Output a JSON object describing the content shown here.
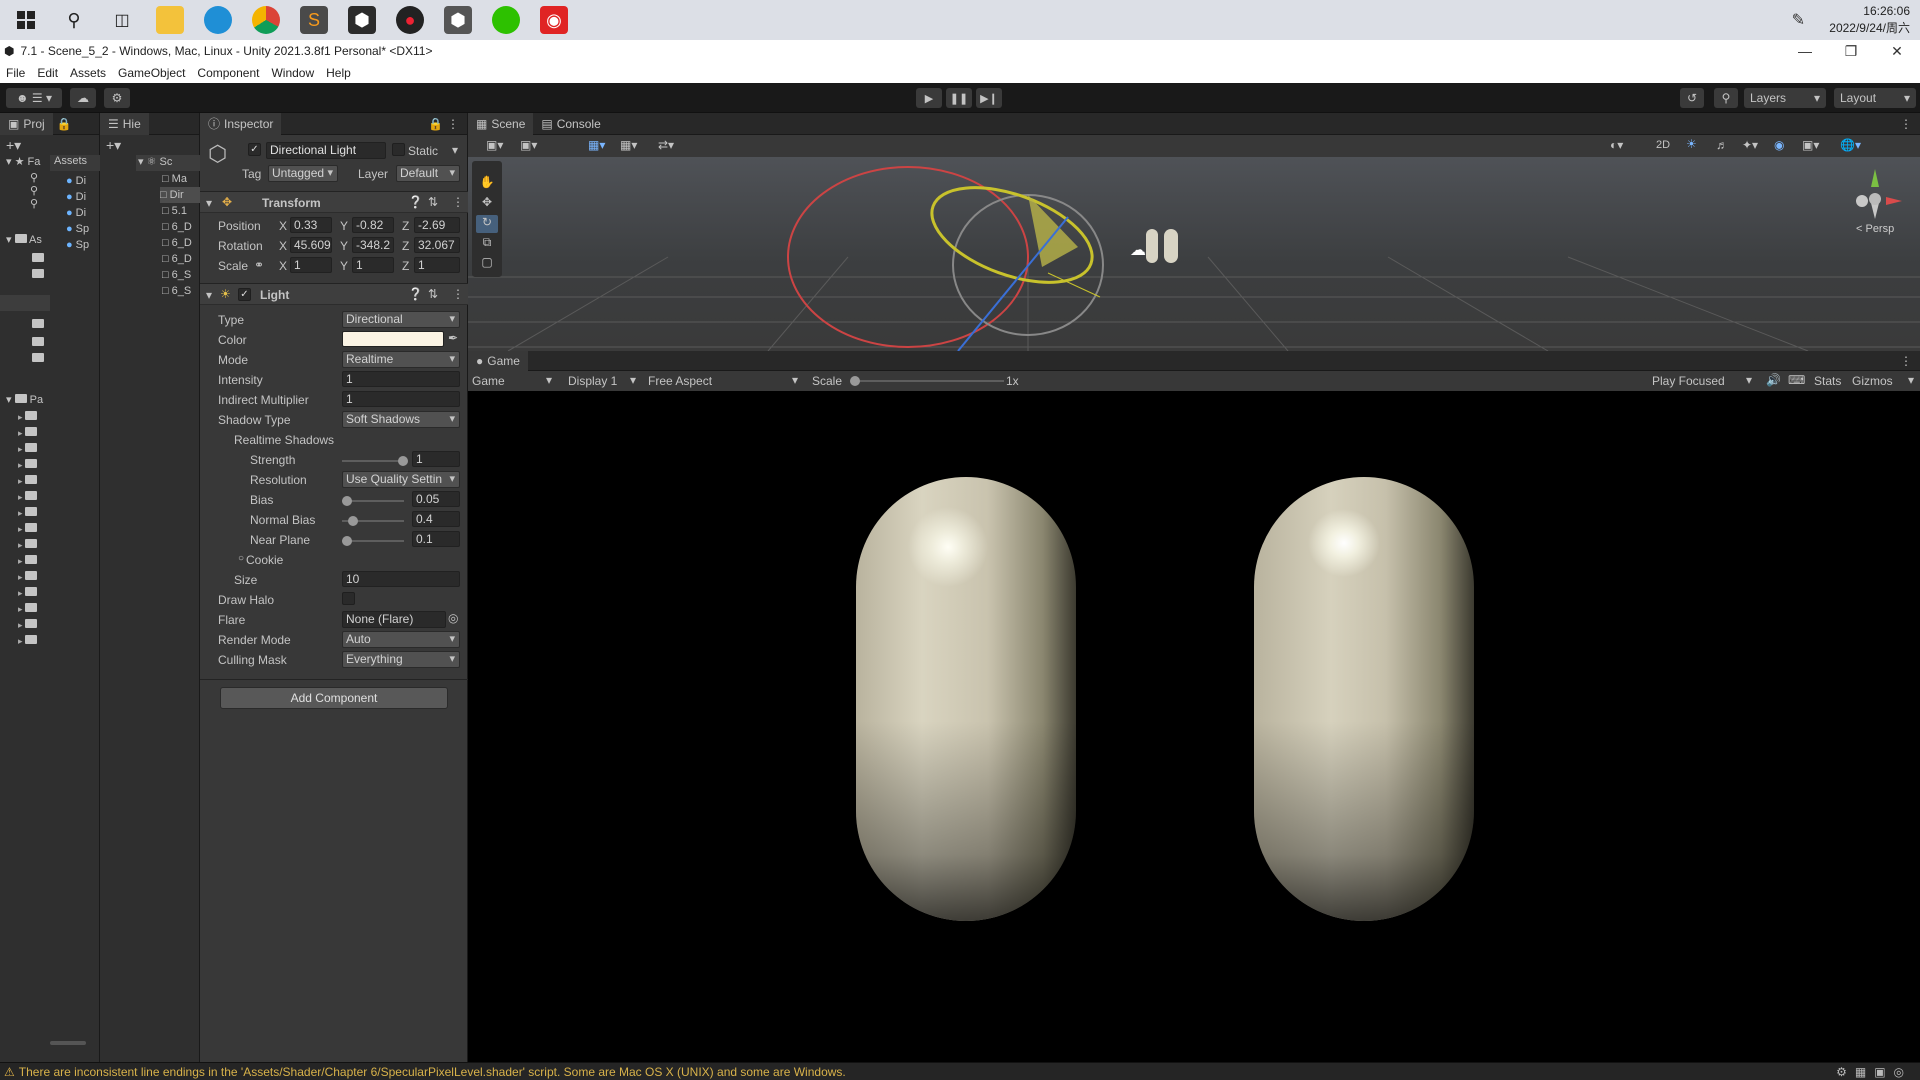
{
  "taskbar": {
    "icons": [
      "windows-logo-icon",
      "search-icon",
      "task-view-icon",
      "file-explorer-icon",
      "edge-icon",
      "chrome-icon",
      "sublime-icon",
      "unity-hub-icon",
      "davinci-icon",
      "unity-icon",
      "wechat-icon",
      "netease-music-icon"
    ],
    "time": "16:26:06",
    "date": "2022/9/24/周六"
  },
  "titlebar": {
    "text": "7.1 - Scene_5_2 - Windows, Mac, Linux - Unity 2021.3.8f1 Personal* <DX11>",
    "minimize": "—",
    "maximize": "❐",
    "close": "✕"
  },
  "menu": [
    "File",
    "Edit",
    "Assets",
    "GameObject",
    "Component",
    "Window",
    "Help"
  ],
  "toolbar": {
    "layers": "Layers",
    "layout": "Layout"
  },
  "project_panel": {
    "tab": "Proj",
    "assets_label": "Assets",
    "favorites": "Fa",
    "assets_root": "As",
    "packages": "Pa",
    "items": [
      "Di",
      "Di",
      "Di",
      "Sp",
      "Sp"
    ]
  },
  "hierarchy": {
    "tab": "Hie",
    "scene": "Sc",
    "items": [
      "Ma",
      "Dir",
      "5.1",
      "6_D",
      "6_D",
      "6_D",
      "6_S",
      "6_S"
    ]
  },
  "inspector": {
    "tab": "Inspector",
    "object_name": "Directional Light",
    "static_label": "Static",
    "tag_label": "Tag",
    "tag_value": "Untagged",
    "layer_label": "Layer",
    "layer_value": "Default",
    "transform": {
      "title": "Transform",
      "position_label": "Position",
      "rotation_label": "Rotation",
      "scale_label": "Scale",
      "x": "X",
      "y": "Y",
      "z": "Z",
      "position": [
        "0.33",
        "-0.82",
        "-2.69"
      ],
      "rotation": [
        "45.609",
        "-348.2",
        "32.067"
      ],
      "scale": [
        "1",
        "1",
        "1"
      ]
    },
    "light": {
      "title": "Light",
      "type_label": "Type",
      "type_value": "Directional",
      "color_label": "Color",
      "color_value": "#fbf4e4",
      "mode_label": "Mode",
      "mode_value": "Realtime",
      "intensity_label": "Intensity",
      "intensity_value": "1",
      "indirect_label": "Indirect Multiplier",
      "indirect_value": "1",
      "shadow_type_label": "Shadow Type",
      "shadow_type_value": "Soft Shadows",
      "realtime_shadows_label": "Realtime Shadows",
      "strength_label": "Strength",
      "strength_value": "1",
      "resolution_label": "Resolution",
      "resolution_value": "Use Quality Settin",
      "bias_label": "Bias",
      "bias_value": "0.05",
      "normal_bias_label": "Normal Bias",
      "normal_bias_value": "0.4",
      "near_plane_label": "Near Plane",
      "near_plane_value": "0.1",
      "cookie_label": "Cookie",
      "size_label": "Size",
      "size_value": "10",
      "draw_halo_label": "Draw Halo",
      "flare_label": "Flare",
      "flare_value": "None (Flare)",
      "render_mode_label": "Render Mode",
      "render_mode_value": "Auto",
      "culling_mask_label": "Culling Mask",
      "culling_mask_value": "Everything"
    },
    "add_component": "Add Component"
  },
  "scene": {
    "tab_scene": "Scene",
    "tab_console": "Console",
    "twod": "2D",
    "persp": "< Persp"
  },
  "game": {
    "tab": "Game",
    "mode": "Game",
    "display": "Display 1",
    "aspect": "Free Aspect",
    "scale_label": "Scale",
    "scale_value": "1x",
    "play_focused": "Play Focused",
    "stats": "Stats",
    "gizmos": "Gizmos"
  },
  "status": {
    "message": "There are inconsistent line endings in the 'Assets/Shader/Chapter 6/SpecularPixelLevel.shader' script. Some are Mac OS X (UNIX) and some are Windows."
  }
}
